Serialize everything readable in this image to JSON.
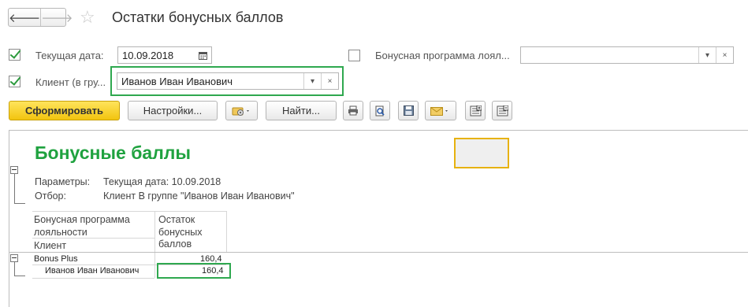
{
  "window": {
    "title": "Остатки бонусных баллов",
    "back_glyph": "🡐",
    "forward_glyph": "🡒",
    "star_glyph": "☆"
  },
  "filters": {
    "current_date": {
      "label": "Текущая дата:",
      "value": "10.09.2018",
      "checked": true
    },
    "client": {
      "label": "Клиент (в гру...",
      "value": "Иванов Иван Иванович",
      "checked": true
    },
    "bonus_program": {
      "label": "Бонусная программа лоял...",
      "value": "",
      "checked": false
    },
    "clear_glyph": "×",
    "dropdown_glyph": "▾",
    "dots_glyph": "..."
  },
  "toolbar": {
    "generate_label": "Сформировать",
    "settings_label": "Настройки...",
    "find_label": "Найти..."
  },
  "report": {
    "title": "Бонусные баллы",
    "params_label": "Параметры:",
    "params_value": "Текущая дата: 10.09.2018",
    "filter_label": "Отбор:",
    "filter_value": "Клиент В группе \"Иванов Иван Иванович\"",
    "col1_header_line1": "Бонусная программа",
    "col1_header_line2": "лояльности",
    "col1_header_line3": "Клиент",
    "col2_header_line1": "Остаток",
    "col2_header_line2": "бонусных",
    "col2_header_line3": "баллов",
    "rows": [
      {
        "name": "Bonus Plus",
        "value": "160,4"
      },
      {
        "name": "Иванов Иван Иванович",
        "value": "160,4"
      }
    ]
  },
  "colors": {
    "accent_green": "#1fa23f",
    "highlight_green": "#2fa84f",
    "primary_yellow": "#f2c40f",
    "box_orange": "#e7b20f"
  }
}
